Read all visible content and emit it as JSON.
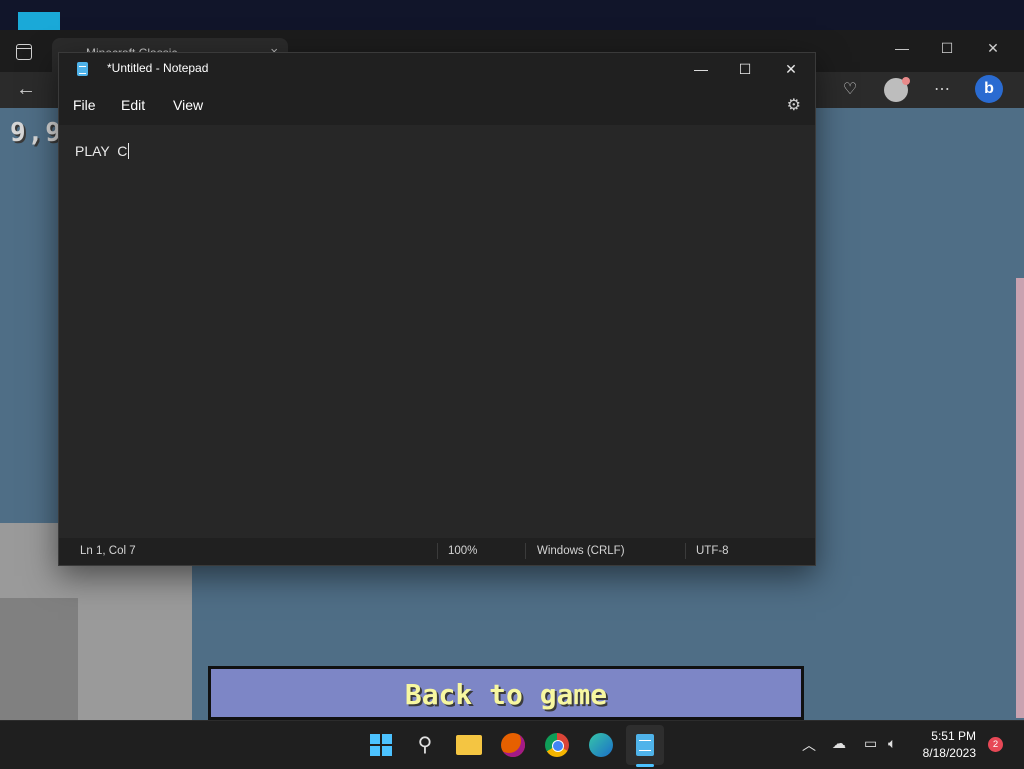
{
  "browser": {
    "tab_title": "Minecraft Classic",
    "tab_close": "×"
  },
  "game": {
    "score": "9,9",
    "back_to_game": "Back to game"
  },
  "notepad": {
    "title": "*Untitled - Notepad",
    "menus": [
      "File",
      "Edit",
      "View"
    ],
    "content": "PLAY  C",
    "status": {
      "position": "Ln 1, Col 7",
      "zoom": "100%",
      "line_ending": "Windows (CRLF)",
      "encoding": "UTF-8"
    }
  },
  "taskbar": {
    "time": "5:51 PM",
    "date": "8/18/2023",
    "notification_count": "2",
    "apps": [
      "start",
      "search",
      "file-explorer",
      "firefox",
      "chrome",
      "edge",
      "notepad"
    ]
  },
  "colors": {
    "accent": "#4cc2ff",
    "notepad_bg": "#272727",
    "game_sky": "#4f6e86",
    "back_button": "#7d86c6"
  }
}
